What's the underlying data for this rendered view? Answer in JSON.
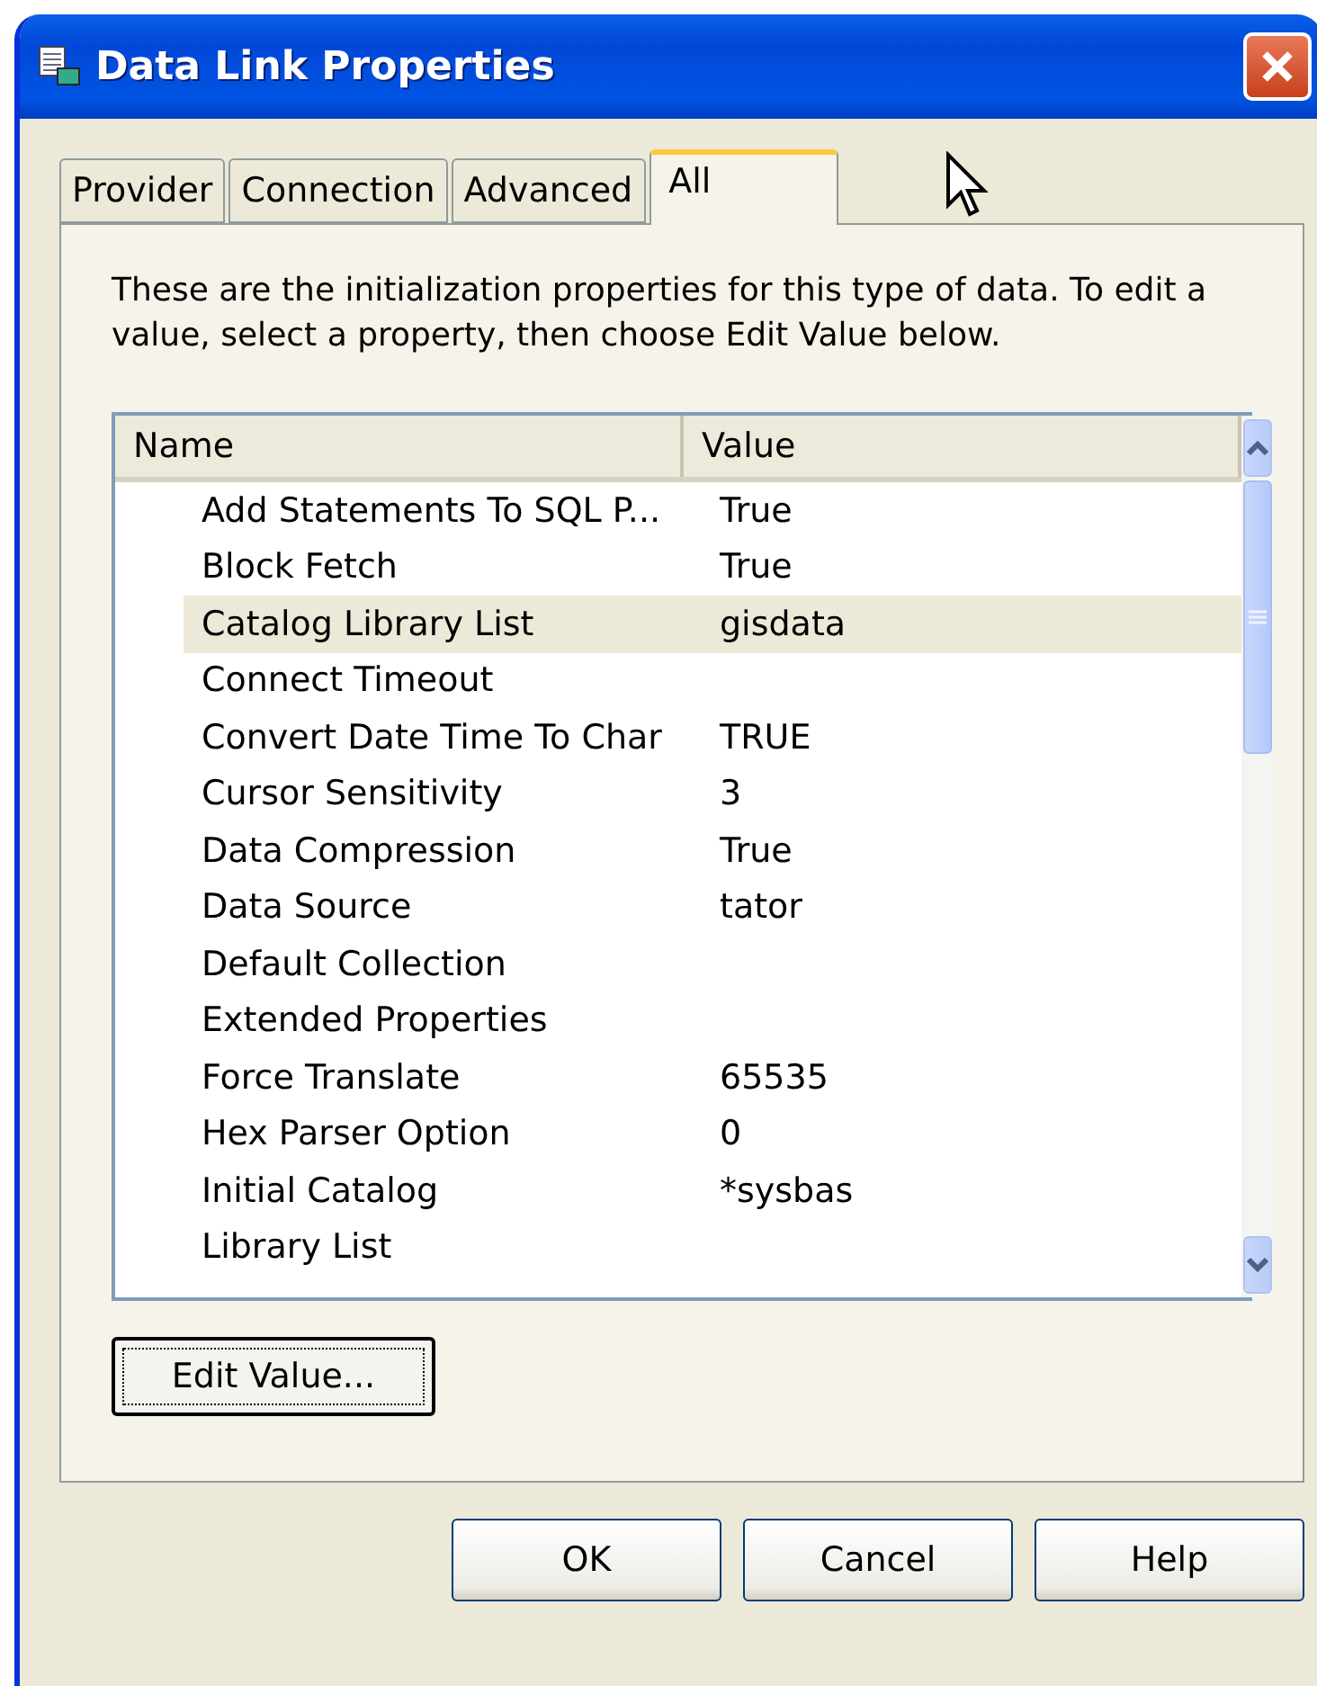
{
  "window": {
    "title": "Data Link Properties"
  },
  "tabs": [
    {
      "label": "Provider",
      "selected": false
    },
    {
      "label": "Connection",
      "selected": false
    },
    {
      "label": "Advanced",
      "selected": false
    },
    {
      "label": "All",
      "selected": true
    }
  ],
  "description": "These are the initialization properties for this type of data. To edit a value, select a property, then choose Edit Value below.",
  "table": {
    "columns": [
      "Name",
      "Value"
    ],
    "rows": [
      {
        "name": "Add Statements To SQL P...",
        "value": "True",
        "selected": false
      },
      {
        "name": "Block Fetch",
        "value": "True",
        "selected": false
      },
      {
        "name": "Catalog Library List",
        "value": "gisdata",
        "selected": true
      },
      {
        "name": "Connect Timeout",
        "value": "",
        "selected": false
      },
      {
        "name": "Convert Date Time To Char",
        "value": "TRUE",
        "selected": false
      },
      {
        "name": "Cursor Sensitivity",
        "value": "3",
        "selected": false
      },
      {
        "name": "Data Compression",
        "value": "True",
        "selected": false
      },
      {
        "name": "Data Source",
        "value": "tator",
        "selected": false
      },
      {
        "name": "Default Collection",
        "value": "",
        "selected": false
      },
      {
        "name": "Extended Properties",
        "value": "",
        "selected": false
      },
      {
        "name": "Force Translate",
        "value": "65535",
        "selected": false
      },
      {
        "name": "Hex Parser Option",
        "value": "0",
        "selected": false
      },
      {
        "name": "Initial Catalog",
        "value": "*sysbas",
        "selected": false
      },
      {
        "name": "Library List",
        "value": "",
        "selected": false
      }
    ]
  },
  "edit_button": "Edit Value...",
  "buttons": [
    "OK",
    "Cancel",
    "Help"
  ]
}
